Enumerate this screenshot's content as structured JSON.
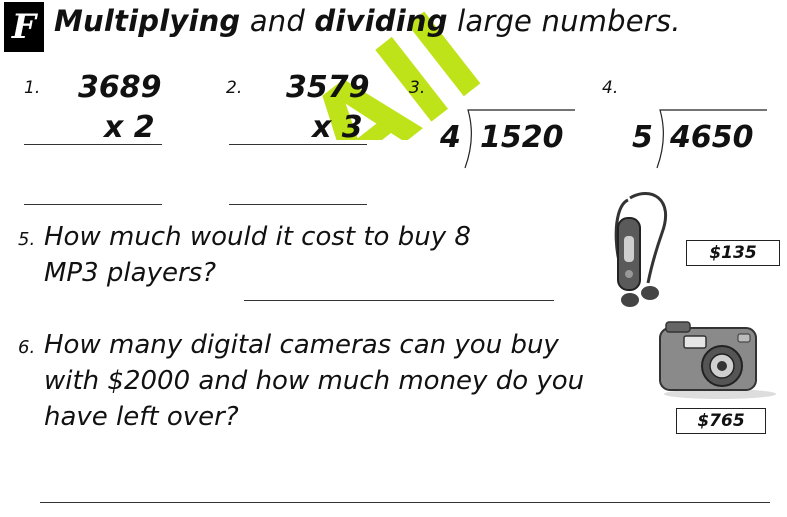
{
  "section_badge": "F",
  "title": {
    "w1": "Multiplying",
    "w2": "and",
    "w3": "dividing",
    "w4": "large numbers."
  },
  "watermark_text": "All",
  "problems": [
    {
      "number": "1.",
      "operand": "3689",
      "multiplier": "x 2"
    },
    {
      "number": "2.",
      "operand": "3579",
      "multiplier": "x 3"
    },
    {
      "number": "3.",
      "divisor": "4",
      "dividend": "1520"
    },
    {
      "number": "4.",
      "divisor": "5",
      "dividend": "4650"
    }
  ],
  "questions": [
    {
      "number": "5.",
      "lines": [
        "How much would it cost to buy 8",
        "MP3 players?"
      ],
      "price": "$135",
      "item_icon": "mp3-player-icon"
    },
    {
      "number": "6.",
      "lines": [
        "How many digital cameras can you buy",
        "with $2000 and how much money do you",
        "have left over?"
      ],
      "price": "$765",
      "item_icon": "camera-icon"
    }
  ],
  "colors": {
    "watermark": "#b8e000",
    "badge_bg": "#000000",
    "ink": "#111111"
  }
}
